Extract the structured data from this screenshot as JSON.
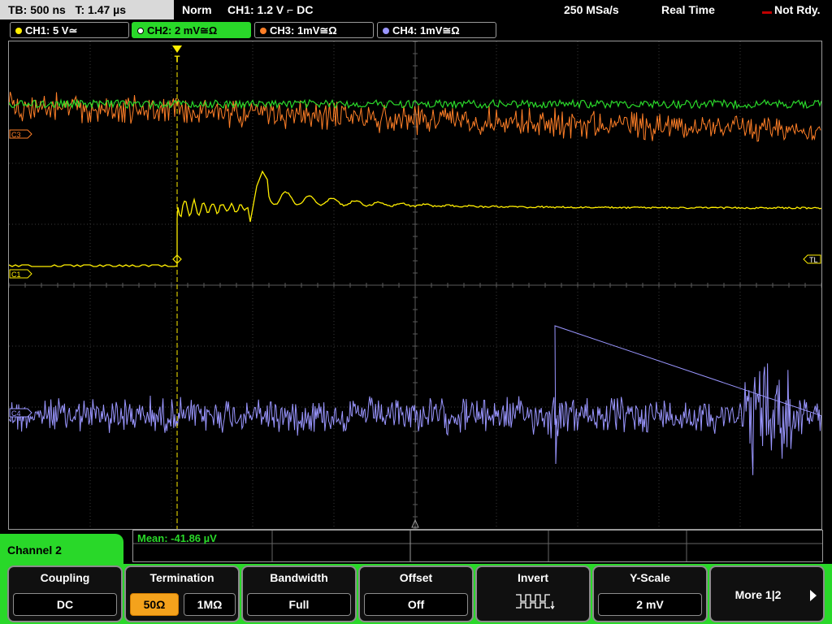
{
  "topbar": {
    "timebase": "TB: 500 ns   T: 1.47 µs",
    "trigger_mode": "Norm",
    "trigger_info": "CH1: 1.2 V ⌐ DC",
    "sample_rate": "250 MSa/s",
    "acq_mode": "Real Time",
    "status": "Not Rdy."
  },
  "channel_tabs": [
    {
      "label": "CH1: 5 V≃",
      "color": "#ffee00",
      "active": false
    },
    {
      "label": "CH2: 2 mV≅Ω",
      "color": "#29d829",
      "active": true
    },
    {
      "label": "CH3: 1mV≅Ω",
      "color": "#ff7f27",
      "active": false
    },
    {
      "label": "CH4: 1mV≅Ω",
      "color": "#9a96ff",
      "active": false
    }
  ],
  "markers": {
    "c3": "C3",
    "c1": "C1",
    "c4": "C4",
    "tl": "TL",
    "trigger": "T"
  },
  "measurement": {
    "mean": "Mean: -41.86 µV"
  },
  "menu": {
    "channel_title": "Channel 2",
    "coupling": {
      "title": "Coupling",
      "value": "DC"
    },
    "termination": {
      "title": "Termination",
      "options": [
        "50Ω",
        "1MΩ"
      ],
      "selected": "50Ω"
    },
    "bandwidth": {
      "title": "Bandwidth",
      "value": "Full"
    },
    "offset": {
      "title": "Offset",
      "value": "Off"
    },
    "invert": {
      "title": "Invert"
    },
    "yscale": {
      "title": "Y-Scale",
      "value": "2 mV"
    },
    "more": {
      "label": "More 1|2"
    }
  },
  "colors": {
    "ch1": "#ffee00",
    "ch2": "#29d829",
    "ch3": "#ff7f27",
    "ch4": "#9a96ff",
    "menu_accent": "#29d829",
    "selected_option": "#f4a21c"
  }
}
